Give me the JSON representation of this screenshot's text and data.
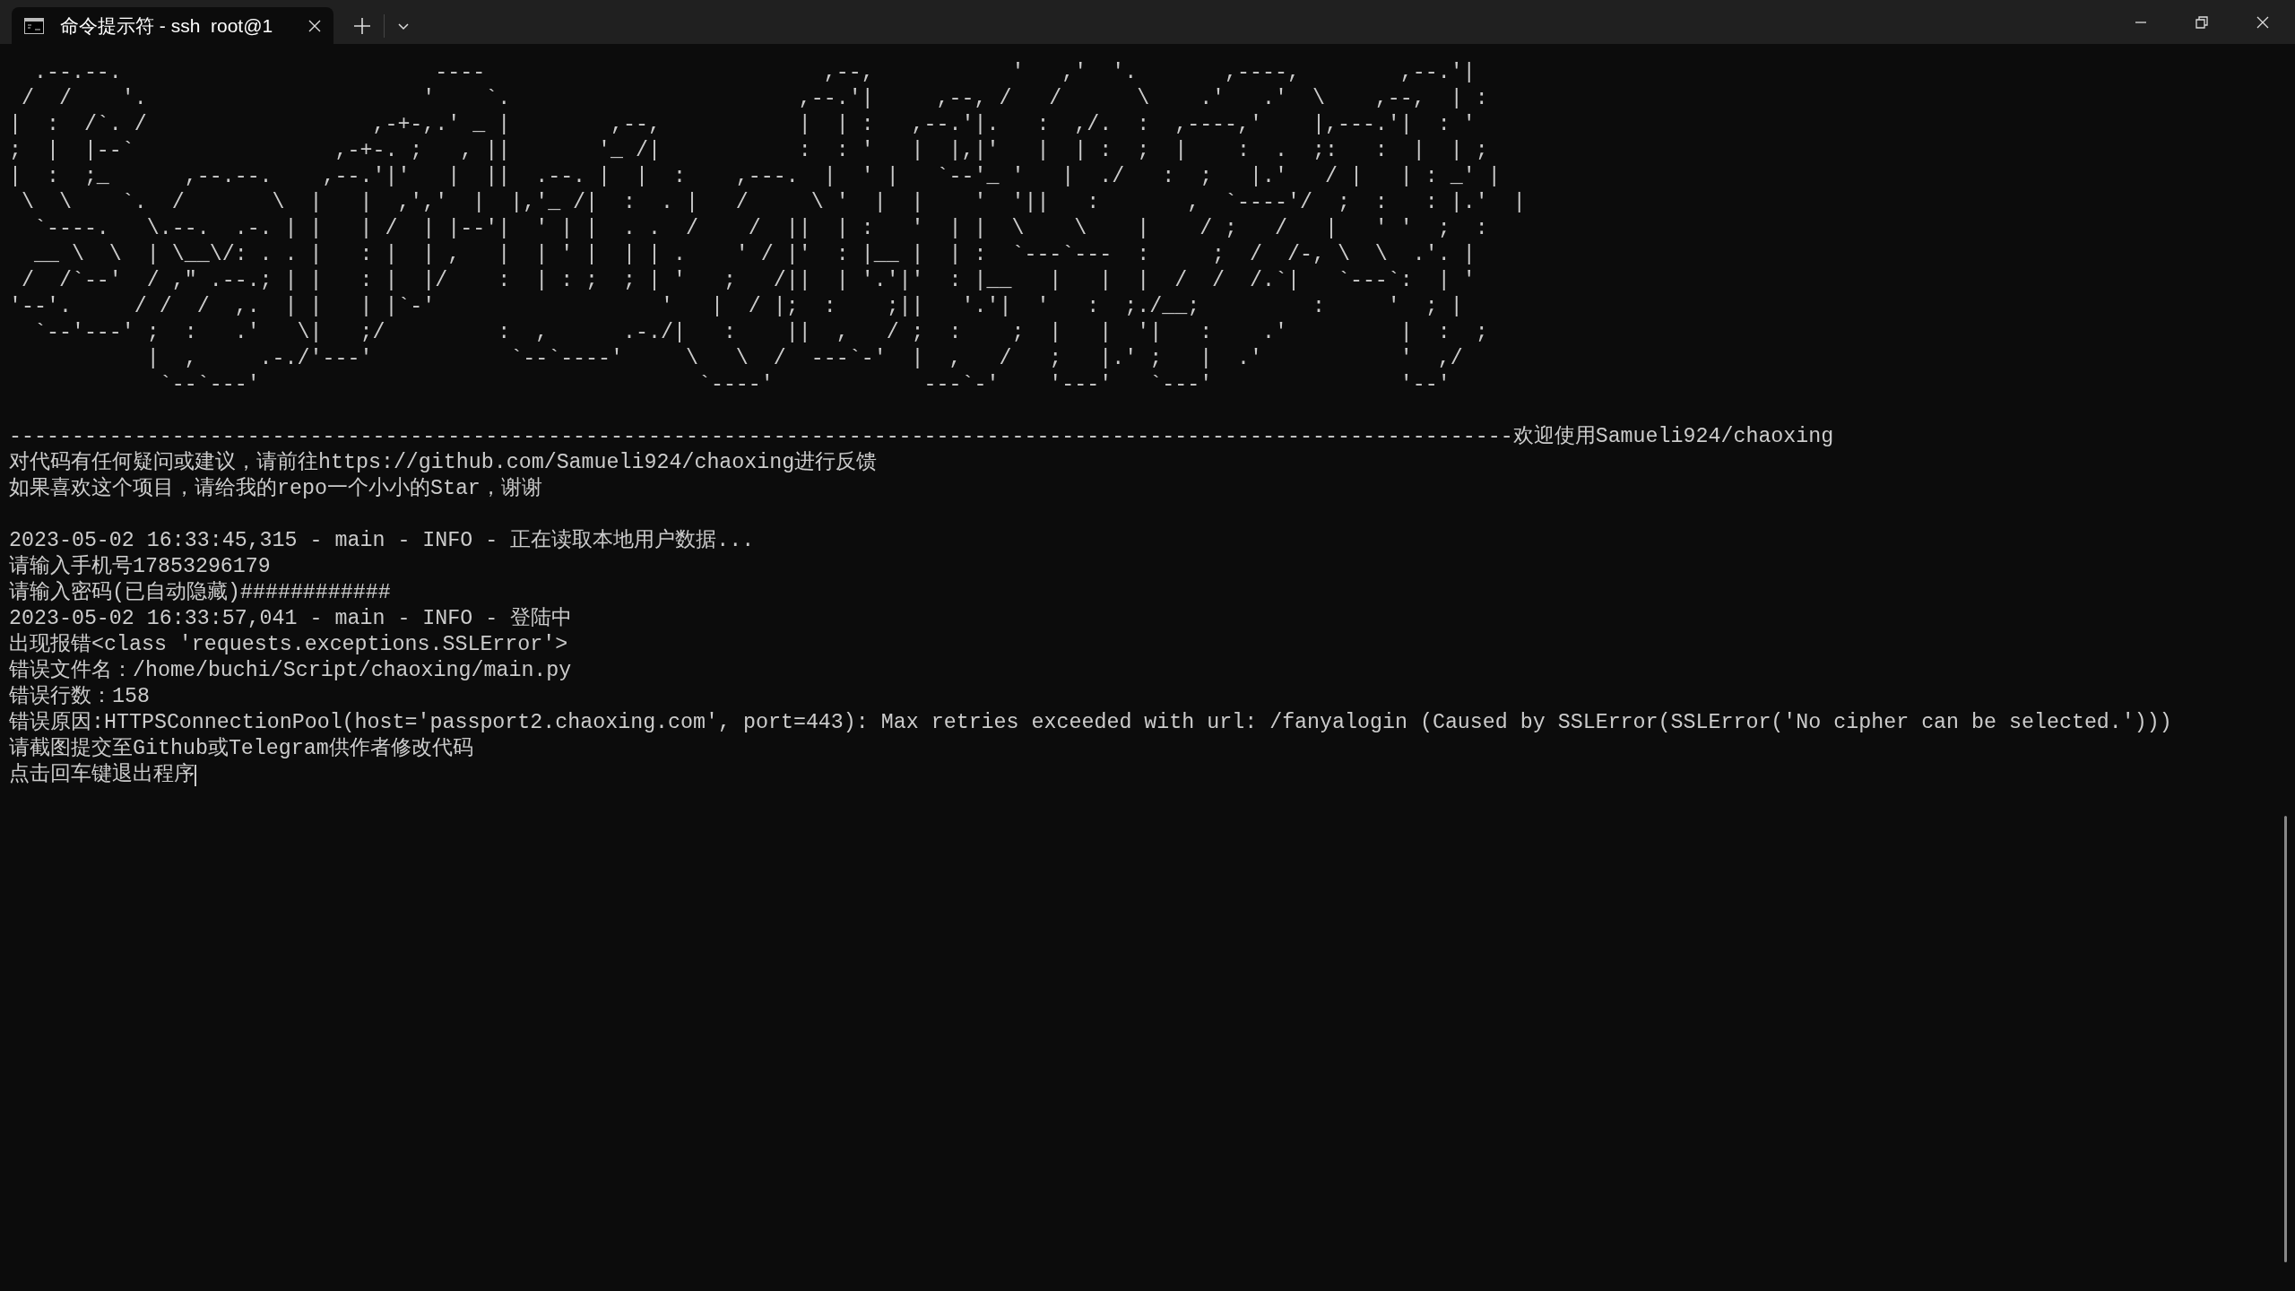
{
  "tab": {
    "title": "命令提示符 - ssh  root@1"
  },
  "terminal": {
    "banner": [
      "  .--.--.                         ----                           ,--,           '   ,'  '.       ,----,        ,--.'|",
      " /  /    '.                      '    `.                       ,--.'|     ,--, /   /      \\    .'   .'  \\    ,--,  | :",
      "|  :  /`. /                  ,-+-,.' _ |        ,--,           |  | :   ,--.'|.   :  ,/.  :  ,----,'    |,---.'|  : '",
      ";  |  |--`                ,-+-. ;   , ||       '_ /|           :  : '   |  |,|'   |  | :  ;  |    :  .  ;:   :  |  | ;",
      "|  :  ;_      ,--.--.    ,--.'|'   |  ||  .--. |  |  :    ,---.  |  ' |   `--'_ '   |  ./   :  ;   |.'   / |   | : _' |",
      " \\  \\    `.  /       \\  |   |  ,','  |  |,'_ /|  :  . |   /     \\ '  |  |    '  '||   :       ,  `----'/  ;  :   : |.'  |",
      "  `----.   \\.--.  .-. | |   | /  | |--'|  ' | |  . .  /    /  ||  | :   '  | |  \\    \\    |    / ;   /   |   ' '  ;  :",
      "  __ \\  \\  | \\__\\/: . . |   : |  | ,   |  | ' |  | | .    ' / |'  : |__ |  | :  `---`---  :     ;  /  /-, \\  \\  .'. |",
      " /  /`--'  / ,\" .--.; | |   : |  |/    :  | : ;  ; | '   ;   /||  | '.'|'  : |__   |   |  |  /  /  /.`|   `---`:  | '",
      "'--'.     / /  /  ,.  | |   | |`-'                  '   |  / |;  :    ;||   '.'|  '   :  ;./__;         :     '  ; |",
      "  `--'---' ;  :   .'   \\|   ;/         :  ,      .-./|   :    ||  ,   / ;  :    ;  |   |  '|   :    .'         |  :  ;",
      "           |  ,     .-./'---'           `--`----'     \\   \\  /  ---`-'  |  ,   /   ;   |.' ;   |  .'           '  ,/",
      "            `--`---'                                   `----'            ---`-'    '---'   `---'               '--'"
    ],
    "blocks": [
      [
        "------------------------------------------------------------------------------------------------------------------------欢迎使用Samueli924/chaoxing",
        "对代码有任何疑问或建议，请前往https://github.com/Samueli924/chaoxing进行反馈",
        "如果喜欢这个项目，请给我的repo一个小小的Star，谢谢"
      ],
      [
        "2023-05-02 16:33:45,315 - main - INFO - 正在读取本地用户数据...",
        "请输入手机号17853296179",
        "请输入密码(已自动隐藏)############",
        "2023-05-02 16:33:57,041 - main - INFO - 登陆中",
        "出现报错<class 'requests.exceptions.SSLError'>",
        "错误文件名：/home/buchi/Script/chaoxing/main.py",
        "错误行数：158",
        "错误原因:HTTPSConnectionPool(host='passport2.chaoxing.com', port=443): Max retries exceeded with url: /fanyalogin (Caused by SSLError(SSLError('No cipher can be selected.')))",
        "请截图提交至Github或Telegram供作者修改代码",
        "点击回车键退出程序"
      ]
    ]
  }
}
